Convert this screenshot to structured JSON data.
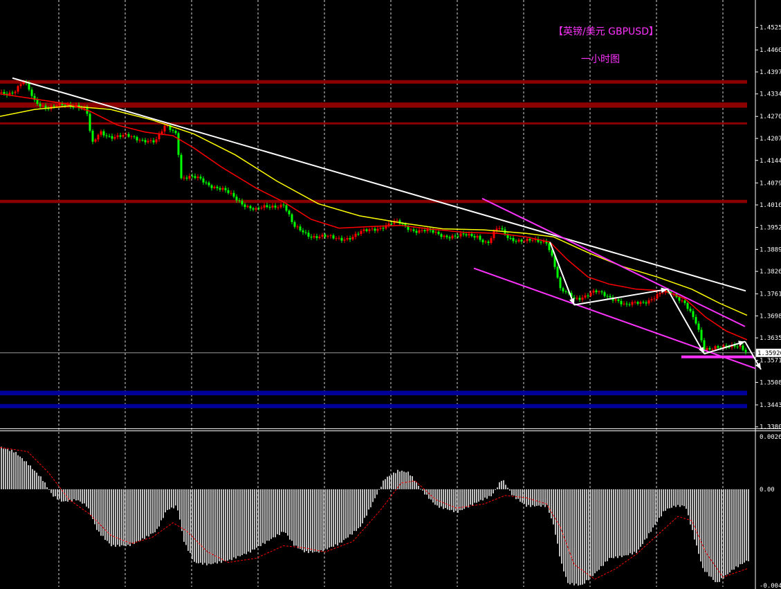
{
  "chart_data": [
    {
      "type": "candlestick",
      "title": "【英镑/美元 GBPUSD】",
      "subtitle": "一小时图",
      "ylim": [
        1.338,
        1.456
      ],
      "y_ticks": [
        "1.45250",
        "1.44605",
        "1.43975",
        "1.43345",
        "1.42700",
        "1.42070",
        "1.41440",
        "1.40795",
        "1.40165",
        "1.39520",
        "1.38890",
        "1.38260",
        "1.37615",
        "1.36985",
        "1.36355",
        "1.35710",
        "1.35080",
        "1.34435",
        "1.33805"
      ],
      "current_price": "1.35926",
      "colors": {
        "up": "#ff0000",
        "down": "#00ff00",
        "ma_fast": "#ff0000",
        "ma_slow": "#ffff00",
        "trendline": "#ffffff",
        "channel": "#ff33ff",
        "resistance": "#8b0000",
        "support": "#000099",
        "grid": "#ffffff"
      },
      "resistance_levels": [
        {
          "from": 1.4364,
          "to": 1.4374
        },
        {
          "from": 1.4295,
          "to": 1.431
        },
        {
          "from": 1.4247,
          "to": 1.4253
        },
        {
          "from": 1.4022,
          "to": 1.4031
        }
      ],
      "support_levels": [
        {
          "from": 1.3471,
          "to": 1.3484
        },
        {
          "from": 1.3438,
          "to": 1.3446
        }
      ],
      "close_path": [
        [
          0,
          1.4338
        ],
        [
          20,
          1.4342
        ],
        [
          35,
          1.4368
        ],
        [
          50,
          1.4315
        ],
        [
          70,
          1.4295
        ],
        [
          90,
          1.43
        ],
        [
          110,
          1.4305
        ],
        [
          125,
          1.429
        ],
        [
          133,
          1.4185
        ],
        [
          145,
          1.4225
        ],
        [
          160,
          1.4215
        ],
        [
          185,
          1.421
        ],
        [
          210,
          1.4205
        ],
        [
          225,
          1.4195
        ],
        [
          240,
          1.4245
        ],
        [
          255,
          1.4225
        ],
        [
          262,
          1.4095
        ],
        [
          290,
          1.409
        ],
        [
          320,
          1.406
        ],
        [
          345,
          1.403
        ],
        [
          370,
          1.4
        ],
        [
          395,
          1.4015
        ],
        [
          410,
          1.402
        ],
        [
          425,
          1.395
        ],
        [
          450,
          1.393
        ],
        [
          480,
          1.392
        ],
        [
          510,
          1.3925
        ],
        [
          540,
          1.395
        ],
        [
          575,
          1.3965
        ],
        [
          600,
          1.3945
        ],
        [
          630,
          1.3935
        ],
        [
          660,
          1.3925
        ],
        [
          690,
          1.393
        ],
        [
          705,
          1.3905
        ],
        [
          720,
          1.395
        ],
        [
          735,
          1.3925
        ],
        [
          760,
          1.391
        ],
        [
          790,
          1.3915
        ],
        [
          800,
          1.386
        ],
        [
          810,
          1.377
        ],
        [
          830,
          1.375
        ],
        [
          860,
          1.3765
        ],
        [
          890,
          1.375
        ],
        [
          905,
          1.3725
        ],
        [
          930,
          1.374
        ],
        [
          960,
          1.3765
        ],
        [
          975,
          1.376
        ],
        [
          990,
          1.374
        ],
        [
          1005,
          1.368
        ],
        [
          1018,
          1.36
        ],
        [
          1035,
          1.3615
        ],
        [
          1055,
          1.3605
        ],
        [
          1070,
          1.361
        ],
        [
          1080,
          1.36
        ]
      ],
      "ma_fast": [
        [
          0,
          1.4335
        ],
        [
          50,
          1.432
        ],
        [
          100,
          1.4305
        ],
        [
          130,
          1.4285
        ],
        [
          170,
          1.4245
        ],
        [
          210,
          1.4225
        ],
        [
          250,
          1.4215
        ],
        [
          280,
          1.418
        ],
        [
          320,
          1.4125
        ],
        [
          370,
          1.4065
        ],
        [
          410,
          1.4025
        ],
        [
          450,
          1.3975
        ],
        [
          490,
          1.395
        ],
        [
          540,
          1.3955
        ],
        [
          580,
          1.3958
        ],
        [
          620,
          1.3948
        ],
        [
          670,
          1.3938
        ],
        [
          720,
          1.3935
        ],
        [
          760,
          1.3925
        ],
        [
          795,
          1.391
        ],
        [
          820,
          1.386
        ],
        [
          850,
          1.381
        ],
        [
          880,
          1.379
        ],
        [
          920,
          1.3775
        ],
        [
          960,
          1.377
        ],
        [
          990,
          1.3748
        ],
        [
          1020,
          1.3695
        ],
        [
          1050,
          1.3655
        ],
        [
          1080,
          1.363
        ]
      ],
      "ma_slow": [
        [
          0,
          1.427
        ],
        [
          50,
          1.429
        ],
        [
          100,
          1.43
        ],
        [
          160,
          1.429
        ],
        [
          220,
          1.426
        ],
        [
          280,
          1.422
        ],
        [
          340,
          1.416
        ],
        [
          400,
          1.4085
        ],
        [
          460,
          1.402
        ],
        [
          520,
          1.3985
        ],
        [
          580,
          1.3965
        ],
        [
          640,
          1.3948
        ],
        [
          700,
          1.3945
        ],
        [
          760,
          1.3935
        ],
        [
          800,
          1.3925
        ],
        [
          850,
          1.388
        ],
        [
          900,
          1.384
        ],
        [
          950,
          1.381
        ],
        [
          1000,
          1.3775
        ],
        [
          1040,
          1.3735
        ],
        [
          1080,
          1.37
        ]
      ],
      "trendline": [
        [
          18,
          1.438
        ],
        [
          1078,
          1.377
        ]
      ],
      "channel_upper": [
        [
          697,
          1.4035
        ],
        [
          1077,
          1.3668
        ]
      ],
      "channel_lower": [
        [
          685,
          1.3835
        ],
        [
          1092,
          1.3548
        ]
      ],
      "support_segment": [
        [
          985,
          1.3581
        ],
        [
          1090,
          1.3581
        ]
      ],
      "arrows": [
        [
          [
            795,
            1.391
          ],
          [
            830,
            1.373
          ]
        ],
        [
          [
            830,
            1.373
          ],
          [
            965,
            1.3775
          ]
        ],
        [
          [
            965,
            1.3775
          ],
          [
            1018,
            1.359
          ]
        ],
        [
          [
            1018,
            1.359
          ],
          [
            1077,
            1.3625
          ]
        ],
        [
          [
            1077,
            1.3625
          ],
          [
            1100,
            1.3545
          ]
        ]
      ]
    },
    {
      "type": "histogram",
      "ylim": [
        -0.00467,
        0.00261
      ],
      "y_ticks": [
        "0.00261",
        "0.00",
        "-0.00467"
      ],
      "colors": {
        "bars": "#c0c0c0",
        "signal": "#ff0000"
      },
      "values": [
        [
          0,
          0.002
        ],
        [
          20,
          0.0018
        ],
        [
          40,
          0.0012
        ],
        [
          60,
          0.0005
        ],
        [
          75,
          -0.0003
        ],
        [
          90,
          -0.0006
        ],
        [
          110,
          -0.0005
        ],
        [
          125,
          -0.0008
        ],
        [
          140,
          -0.002
        ],
        [
          160,
          -0.0027
        ],
        [
          185,
          -0.0027
        ],
        [
          210,
          -0.0023
        ],
        [
          225,
          -0.002
        ],
        [
          240,
          -0.001
        ],
        [
          255,
          -0.0008
        ],
        [
          265,
          -0.0025
        ],
        [
          280,
          -0.0035
        ],
        [
          300,
          -0.0036
        ],
        [
          330,
          -0.0034
        ],
        [
          360,
          -0.003
        ],
        [
          390,
          -0.0024
        ],
        [
          410,
          -0.002
        ],
        [
          425,
          -0.0027
        ],
        [
          440,
          -0.003
        ],
        [
          460,
          -0.003
        ],
        [
          490,
          -0.0026
        ],
        [
          520,
          -0.0018
        ],
        [
          540,
          -0.0005
        ],
        [
          555,
          0.0005
        ],
        [
          575,
          0.0009
        ],
        [
          590,
          0.0008
        ],
        [
          610,
          -0.0001
        ],
        [
          630,
          -0.0008
        ],
        [
          660,
          -0.0011
        ],
        [
          690,
          -0.0006
        ],
        [
          710,
          -0.0003
        ],
        [
          725,
          0.0005
        ],
        [
          740,
          -0.0003
        ],
        [
          760,
          -0.0008
        ],
        [
          790,
          -0.0008
        ],
        [
          800,
          -0.0018
        ],
        [
          810,
          -0.0035
        ],
        [
          820,
          -0.0045
        ],
        [
          840,
          -0.0046
        ],
        [
          860,
          -0.004
        ],
        [
          880,
          -0.0033
        ],
        [
          900,
          -0.0032
        ],
        [
          920,
          -0.003
        ],
        [
          940,
          -0.002
        ],
        [
          960,
          -0.001
        ],
        [
          975,
          -0.0008
        ],
        [
          990,
          -0.0008
        ],
        [
          1000,
          -0.002
        ],
        [
          1015,
          -0.0038
        ],
        [
          1035,
          -0.0045
        ],
        [
          1060,
          -0.0038
        ],
        [
          1080,
          -0.0034
        ]
      ],
      "signal": [
        [
          0,
          0.002
        ],
        [
          40,
          0.0018
        ],
        [
          70,
          0.0008
        ],
        [
          100,
          -0.0005
        ],
        [
          130,
          -0.0012
        ],
        [
          160,
          -0.0022
        ],
        [
          190,
          -0.0026
        ],
        [
          220,
          -0.0023
        ],
        [
          250,
          -0.0016
        ],
        [
          270,
          -0.002
        ],
        [
          300,
          -0.003
        ],
        [
          330,
          -0.0035
        ],
        [
          370,
          -0.0033
        ],
        [
          410,
          -0.0027
        ],
        [
          440,
          -0.0028
        ],
        [
          470,
          -0.003
        ],
        [
          510,
          -0.0025
        ],
        [
          550,
          -0.001
        ],
        [
          580,
          0.0003
        ],
        [
          600,
          0.0004
        ],
        [
          630,
          -0.0005
        ],
        [
          660,
          -0.0009
        ],
        [
          700,
          -0.0007
        ],
        [
          730,
          -0.0003
        ],
        [
          760,
          -0.0004
        ],
        [
          790,
          -0.0007
        ],
        [
          810,
          -0.0018
        ],
        [
          830,
          -0.0036
        ],
        [
          860,
          -0.0043
        ],
        [
          890,
          -0.0038
        ],
        [
          920,
          -0.0031
        ],
        [
          950,
          -0.0022
        ],
        [
          980,
          -0.0013
        ],
        [
          1000,
          -0.0015
        ],
        [
          1020,
          -0.003
        ],
        [
          1045,
          -0.0042
        ],
        [
          1080,
          -0.0038
        ]
      ]
    }
  ]
}
